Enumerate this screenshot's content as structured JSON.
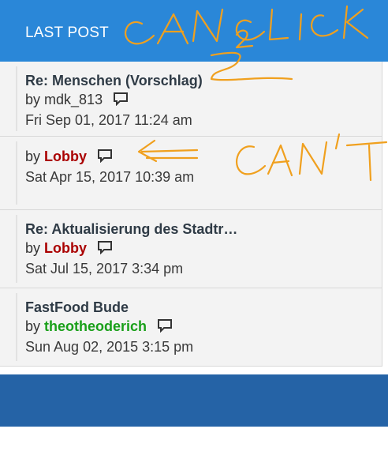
{
  "header": {
    "title": "LAST POST"
  },
  "posts": [
    {
      "topic": "Re: Menschen (Vorschlag)",
      "by": "by",
      "user": "mdk_813",
      "user_color": "#333333",
      "date": "Fri Sep 01, 2017 11:24 am",
      "icon": "chat-icon"
    },
    {
      "topic": "",
      "by": "by",
      "user": "Lobby",
      "user_color": "#aa0000",
      "date": "Sat Apr 15, 2017 10:39 am",
      "icon": "chat-icon"
    },
    {
      "topic": "Re: Aktualisierung des Stadtr…",
      "by": "by",
      "user": "Lobby",
      "user_color": "#aa0000",
      "date": "Sat Jul 15, 2017 3:34 pm",
      "icon": "chat-icon"
    },
    {
      "topic": "FastFood Bude",
      "by": "by",
      "user": "theotheoderich",
      "user_color": "#1aa01a",
      "date": "Sun Aug 02, 2015 3:15 pm",
      "icon": "chat-icon"
    }
  ],
  "annotations": {
    "can_click": "CAN CLICK",
    "cant": "CAN'T",
    "color": "#f0a01e"
  }
}
